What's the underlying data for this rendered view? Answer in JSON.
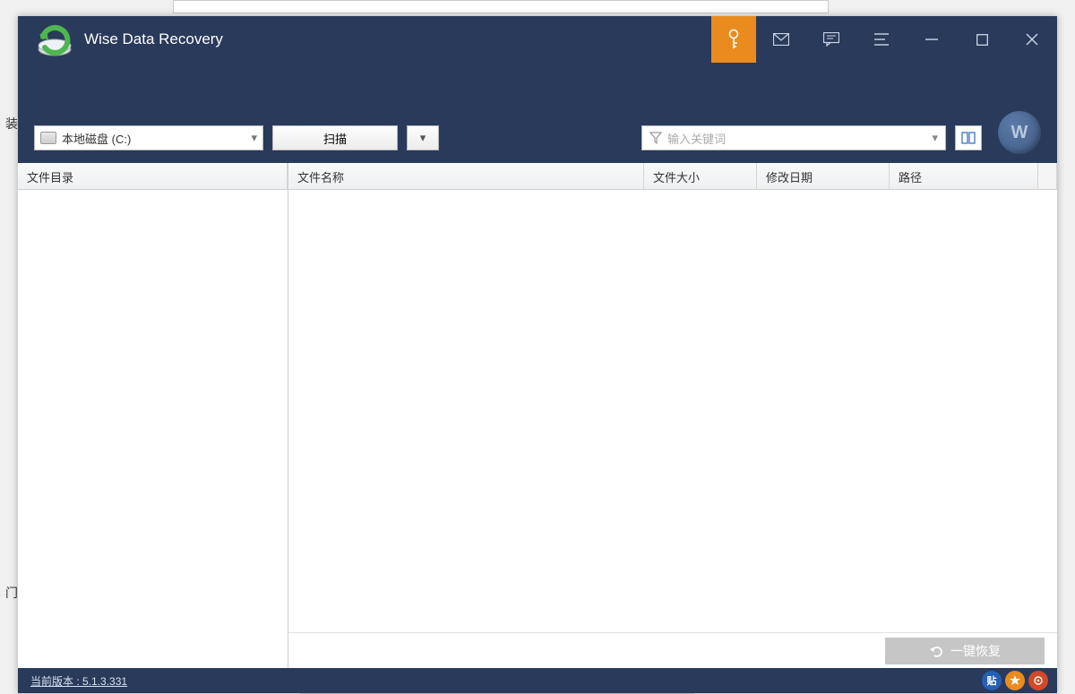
{
  "background": {
    "text1": "装",
    "text2": "门"
  },
  "app": {
    "title": "Wise Data Recovery"
  },
  "titlebar": {
    "key_tooltip": "激活",
    "mail_tooltip": "邮件",
    "feedback_tooltip": "反馈",
    "menu_tooltip": "菜单",
    "min_tooltip": "最小化",
    "max_tooltip": "最大化",
    "close_tooltip": "关闭"
  },
  "toolbar": {
    "drive_selected": "本地磁盘 (C:)",
    "scan_label": "扫描",
    "filter_placeholder": "输入关键词",
    "cloud_letter": "W"
  },
  "columns": {
    "tree_header": "文件目录",
    "name": "文件名称",
    "size": "文件大小",
    "date": "修改日期",
    "path": "路径"
  },
  "actions": {
    "recover_label": "一键恢复"
  },
  "status": {
    "version_label": "当前版本 : 5.1.3.331"
  }
}
